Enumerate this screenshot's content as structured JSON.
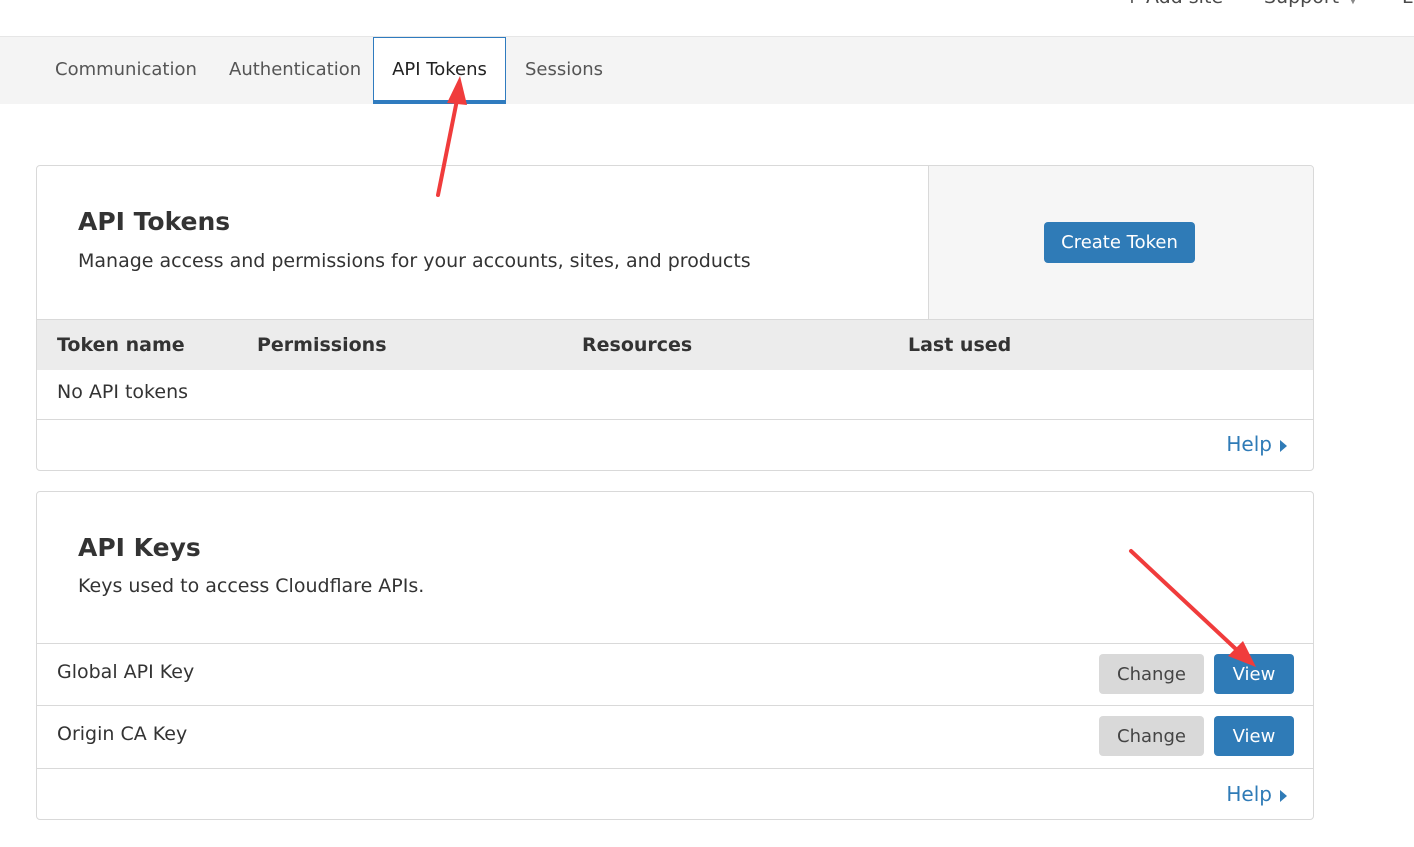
{
  "topbar": {
    "add_site": "+ Add site",
    "support": "Support",
    "support_chevron": "chevron-down-icon",
    "clipped": "L"
  },
  "tabs": [
    {
      "label": "Communication",
      "active": false
    },
    {
      "label": "Authentication",
      "active": false
    },
    {
      "label": "API Tokens",
      "active": true
    },
    {
      "label": "Sessions",
      "active": false
    }
  ],
  "api_tokens": {
    "title": "API Tokens",
    "description": "Manage access and permissions for your accounts, sites, and products",
    "create_button": "Create Token",
    "columns": [
      "Token name",
      "Permissions",
      "Resources",
      "Last used"
    ],
    "empty_text": "No API tokens",
    "help": "Help"
  },
  "api_keys": {
    "title": "API Keys",
    "description": "Keys used to access Cloudflare APIs.",
    "rows": [
      {
        "name": "Global API Key",
        "change": "Change",
        "view": "View"
      },
      {
        "name": "Origin CA Key",
        "change": "Change",
        "view": "View"
      }
    ],
    "help": "Help"
  },
  "colors": {
    "accent": "#2f7bb7",
    "annotation_arrow": "#f03c3c"
  }
}
